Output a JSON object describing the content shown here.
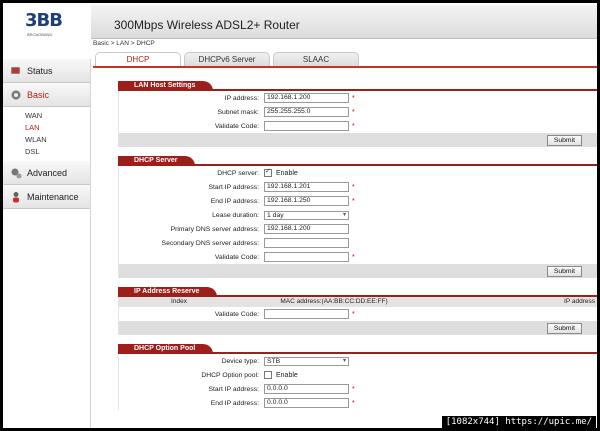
{
  "header": {
    "logo_text": "3BB",
    "logo_sub": "BROADBAND",
    "title": "300Mbps Wireless ADSL2+ Router"
  },
  "breadcrumb": "Basic > LAN > DHCP",
  "tabs": [
    "DHCP",
    "DHCPv6 Server",
    "SLAAC"
  ],
  "sidebar": {
    "status": "Status",
    "basic": "Basic",
    "sub_items": [
      "WAN",
      "LAN",
      "WLAN",
      "DSL"
    ],
    "advanced": "Advanced",
    "maintenance": "Maintenance"
  },
  "lan_host": {
    "title": "LAN Host Settings",
    "ip_label": "IP address:",
    "ip_value": "192.168.1.200",
    "mask_label": "Subnet mask:",
    "mask_value": "255.255.255.0",
    "validate_label": "Validate Code:",
    "submit": "Submit"
  },
  "dhcp_server": {
    "title": "DHCP Server",
    "enable_label": "DHCP server:",
    "enable_text": "Enable",
    "start_label": "Start IP address:",
    "start_value": "192.168.1.201",
    "end_label": "End IP address:",
    "end_value": "192.168.1.250",
    "lease_label": "Lease duration:",
    "lease_value": "1 day",
    "pdns_label": "Primary DNS server address:",
    "pdns_value": "192.168.1.200",
    "sdns_label": "Secondary DNS server address:",
    "validate_label": "Validate Code:",
    "submit": "Submit"
  },
  "ip_reserve": {
    "title": "IP Address Reserve",
    "col_index": "Index",
    "col_mac": "MAC address:(AA:BB:CC:DD:EE:FF)",
    "col_ip": "IP address",
    "validate_label": "Validate Code:",
    "submit": "Submit"
  },
  "option_pool": {
    "title": "DHCP Option Pool",
    "device_label": "Device type:",
    "device_value": "STB",
    "enable_label": "DHCP Option pool:",
    "enable_text": "Enable",
    "start_label": "Start IP address:",
    "start_value": "0.0.0.0",
    "end_label": "End IP address:",
    "end_value": "0.0.0.0"
  },
  "required_mark": "*",
  "watermark": "[1082x744] https://upic.me/",
  "colors": {
    "accent": "#9e1e1a",
    "active_text": "#b0211a",
    "logo": "#1f3f7a"
  }
}
